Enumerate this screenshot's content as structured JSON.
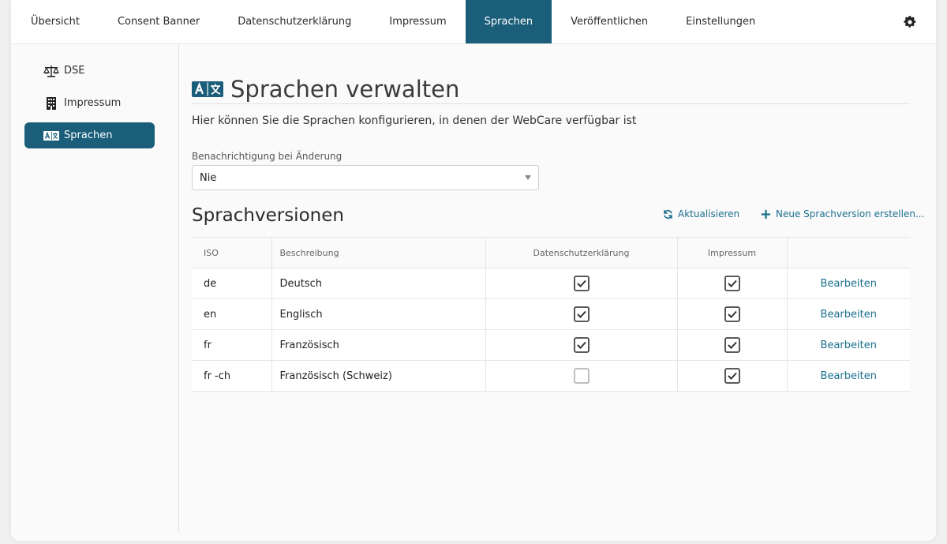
{
  "colors": {
    "accent": "#1b5e7a",
    "link": "#1b6f8e"
  },
  "topnav": {
    "tabs": [
      {
        "label": "Übersicht",
        "active": false
      },
      {
        "label": "Consent Banner",
        "active": false
      },
      {
        "label": "Datenschutzerklärung",
        "active": false
      },
      {
        "label": "Impressum",
        "active": false
      },
      {
        "label": "Sprachen",
        "active": true
      },
      {
        "label": "Veröffentlichen",
        "active": false
      },
      {
        "label": "Einstellungen",
        "active": false
      }
    ],
    "settings_icon": "gear-icon"
  },
  "sidebar": {
    "items": [
      {
        "label": "DSE",
        "icon": "scale-icon",
        "active": false
      },
      {
        "label": "Impressum",
        "icon": "building-icon",
        "active": false
      },
      {
        "label": "Sprachen",
        "icon": "language-icon",
        "active": true
      }
    ]
  },
  "main": {
    "title": "Sprachen verwalten",
    "subtitle": "Hier können Sie die Sprachen konfigurieren, in denen der WebCare verfügbar ist",
    "notify": {
      "label": "Benachrichtigung bei Änderung",
      "value": "Nie"
    },
    "section_title": "Sprachversionen",
    "actions": {
      "refresh": "Aktualisieren",
      "create": "Neue Sprachversion erstellen..."
    },
    "table": {
      "headers": [
        "ISO",
        "Beschreibung",
        "Datenschutzerklärung",
        "Impressum",
        ""
      ],
      "rows": [
        {
          "iso": "de",
          "desc": "Deutsch",
          "dse": true,
          "imp": true,
          "action": "Bearbeiten"
        },
        {
          "iso": "en",
          "desc": "Englisch",
          "dse": true,
          "imp": true,
          "action": "Bearbeiten"
        },
        {
          "iso": "fr",
          "desc": "Französisch",
          "dse": true,
          "imp": true,
          "action": "Bearbeiten"
        },
        {
          "iso": "fr -ch",
          "desc": "Französisch (Schweiz)",
          "dse": false,
          "imp": true,
          "action": "Bearbeiten"
        }
      ]
    }
  }
}
